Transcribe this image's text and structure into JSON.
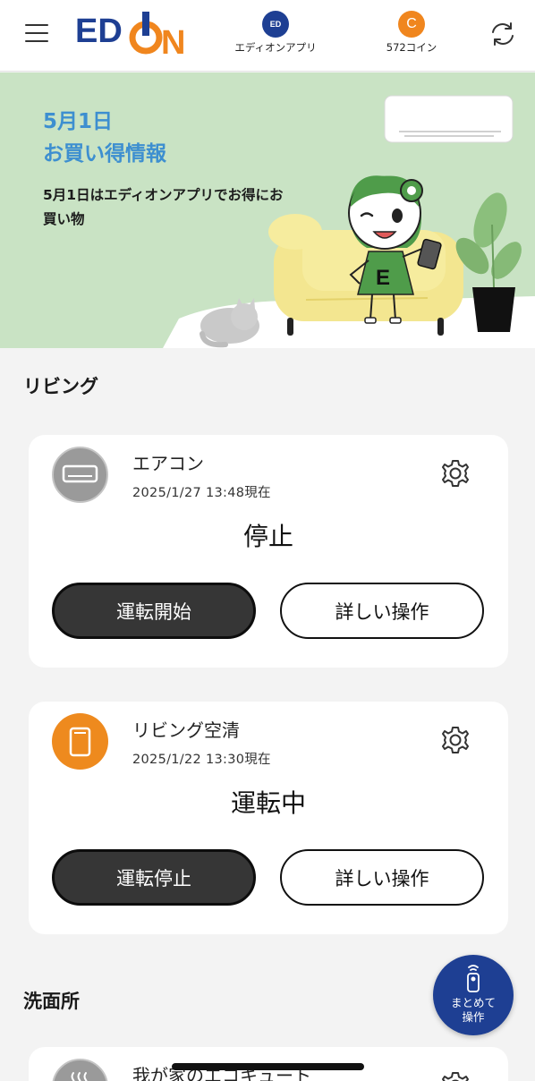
{
  "header": {
    "logo_text": "EDION",
    "app_label": "エディオンアプリ",
    "app_icon_text": "ED",
    "coin_label": "572コイン",
    "coin_icon_text": "C"
  },
  "banner": {
    "date": "5月1日",
    "headline": "お買い得情報",
    "subtext": "5月1日はエディオンアプリでお得にお買い物",
    "mascot_shirt_letter": "E"
  },
  "sections": [
    {
      "title": "リビング",
      "devices": [
        {
          "name": "エアコン",
          "timestamp": "2025/1/27 13:48現在",
          "status": "停止",
          "primary_action": "運転開始",
          "secondary_action": "詳しい操作",
          "icon": "air-conditioner-icon",
          "icon_color": "#9a9a9a"
        },
        {
          "name": "リビング空清",
          "timestamp": "2025/1/22 13:30現在",
          "status": "運転中",
          "primary_action": "運転停止",
          "secondary_action": "詳しい操作",
          "icon": "air-purifier-icon",
          "icon_color": "#ee8a1e"
        }
      ]
    },
    {
      "title": "洗面所",
      "devices": [
        {
          "name": "我が家のエコキュート",
          "icon": "water-heater-icon",
          "icon_color": "#9a9a9a"
        }
      ]
    }
  ],
  "fab": {
    "line1": "まとめて",
    "line2": "操作"
  },
  "colors": {
    "brand_blue": "#1e3f93",
    "brand_orange": "#f0861e",
    "banner_bg": "#c9e3c4",
    "banner_title": "#3d8fd0"
  }
}
